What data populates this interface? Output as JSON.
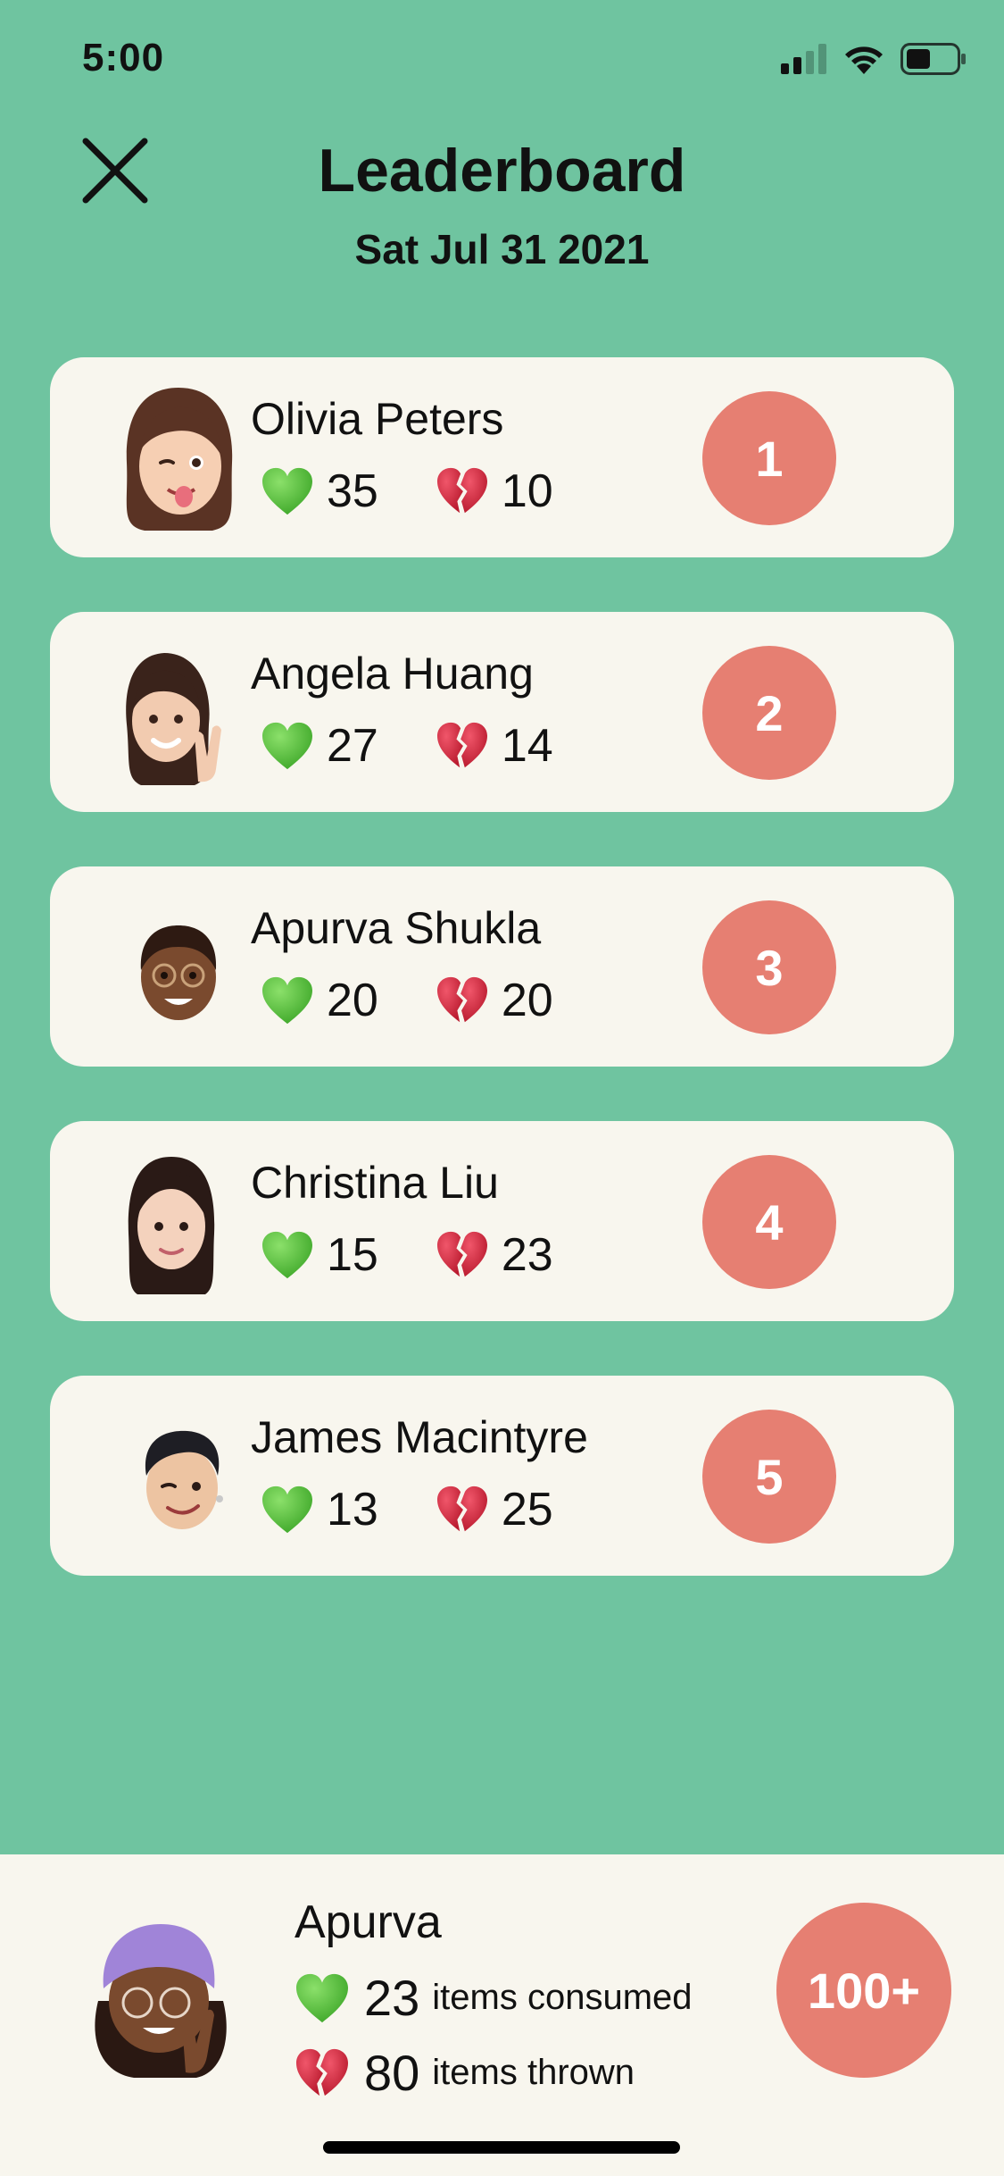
{
  "status_bar": {
    "time": "5:00",
    "icons": [
      "cellular-signal-icon",
      "wifi-icon",
      "battery-icon"
    ]
  },
  "header": {
    "close_icon": "close-icon",
    "title": "Leaderboard",
    "date": "Sat Jul 31 2021"
  },
  "leaderboard": [
    {
      "name": "Olivia Peters",
      "consumed": "35",
      "thrown": "10",
      "rank": "1"
    },
    {
      "name": "Angela Huang",
      "consumed": "27",
      "thrown": "14",
      "rank": "2"
    },
    {
      "name": "Apurva Shukla",
      "consumed": "20",
      "thrown": "20",
      "rank": "3"
    },
    {
      "name": "Christina Liu",
      "consumed": "15",
      "thrown": "23",
      "rank": "4"
    },
    {
      "name": "James Macintyre",
      "consumed": "13",
      "thrown": "25",
      "rank": "5"
    }
  ],
  "current_user": {
    "name": "Apurva",
    "consumed": "23",
    "consumed_label": "items consumed",
    "thrown": "80",
    "thrown_label": "items thrown",
    "rank": "100+"
  },
  "colors": {
    "background": "#6FC4A0",
    "card": "#F8F6EE",
    "rank_badge": "#E67F72",
    "green_heart": "#56C23A",
    "broken_heart": "#D62B3B"
  }
}
